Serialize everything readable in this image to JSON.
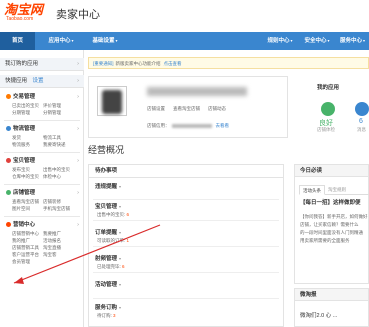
{
  "header": {
    "logo_text": "淘宝网",
    "logo_sub": "Taobao.com",
    "title": "卖家中心"
  },
  "nav": {
    "items": [
      {
        "label": "首页"
      },
      {
        "label": "应用中心"
      },
      {
        "label": "基础设置"
      }
    ],
    "right_items": [
      {
        "label": "规则中心"
      },
      {
        "label": "安全中心"
      },
      {
        "label": "服务中心"
      }
    ]
  },
  "sidebar": {
    "my_apps": "我订购的应用",
    "quick_apps": "快捷应用",
    "quick_setting": "设置",
    "groups": [
      {
        "icon": "trade-icon",
        "title": "交易管理",
        "links": [
          [
            "已卖出的宝贝",
            "评价管理"
          ],
          [
            "分期管理",
            "分销管理"
          ]
        ]
      },
      {
        "icon": "logistics-icon",
        "title": "物流管理",
        "links": [
          [
            "发货",
            "物流工具"
          ],
          [
            "物流服务",
            "我要寄快递"
          ]
        ]
      },
      {
        "icon": "goods-icon",
        "title": "宝贝管理",
        "links": [
          [
            "发布宝贝",
            "出售中的宝贝"
          ],
          [
            "仓库中的宝贝",
            "体检中心"
          ]
        ]
      },
      {
        "icon": "shop-icon",
        "title": "店铺管理",
        "links": [
          [
            "查看淘宝店铺",
            "店铺装修"
          ],
          [
            "图片空间",
            "手机淘宝店铺"
          ]
        ]
      },
      {
        "icon": "marketing-icon",
        "title": "营销中心",
        "links": [
          [
            "店铺营销中心",
            "我要推广"
          ],
          [
            "我的推广",
            "活动报名"
          ],
          [
            "店铺营销工具",
            "淘宝直播"
          ],
          [
            "客户运营平台",
            "淘宝客"
          ],
          [
            "会员管理",
            ""
          ]
        ]
      }
    ]
  },
  "notice": {
    "tag": "[重要通知]",
    "text": "新版卖家中心功能介绍",
    "link": "点击查看"
  },
  "shop": {
    "links": [
      "店铺设置",
      "查看淘宝店铺",
      "店铺动态"
    ],
    "meta_label": "店铺信用：",
    "meta_link": "去看看"
  },
  "my_apps": {
    "title": "我的应用",
    "subtitle": "",
    "app1_label": "良好",
    "app1_desc": "店铺体检",
    "app2_label": "6",
    "app2_desc": "消息"
  },
  "overview": {
    "title": "经营概况"
  },
  "todo": {
    "title": "待办事项",
    "sections": [
      {
        "title": "违规提醒",
        "lines": [
          {
            "text": "",
            "num": ""
          }
        ]
      },
      {
        "title": "宝贝管理",
        "lines": [
          {
            "text": "出售中的宝贝: ",
            "num": "6"
          }
        ]
      },
      {
        "title": "订单提醒",
        "lines": [
          {
            "text": "可读取的订单: ",
            "num": "1"
          }
        ]
      },
      {
        "title": "射频管理",
        "lines": [
          {
            "text": "已处理完毕: ",
            "num": "6"
          }
        ]
      },
      {
        "title": "活动管理",
        "lines": [
          {
            "text": "",
            "num": ""
          }
        ]
      },
      {
        "title": "服务订购",
        "lines": [
          {
            "text": "待订购: ",
            "num": "3"
          }
        ]
      }
    ]
  },
  "today": {
    "title": "今日必读",
    "tabs": [
      "活动头条",
      "淘宝规则"
    ],
    "headline": "【每日一招】这样做即便",
    "items": [
      "",
      "【你问我答】新手开店，如何做好",
      "店铺，让买家信赖？需要什么",
      "的一段时间里面没有人门到精通",
      "用卖家所需要的全面服务"
    ]
  },
  "weitao": {
    "title": "微淘报",
    "body": "微淘们2.0 心 ..."
  }
}
